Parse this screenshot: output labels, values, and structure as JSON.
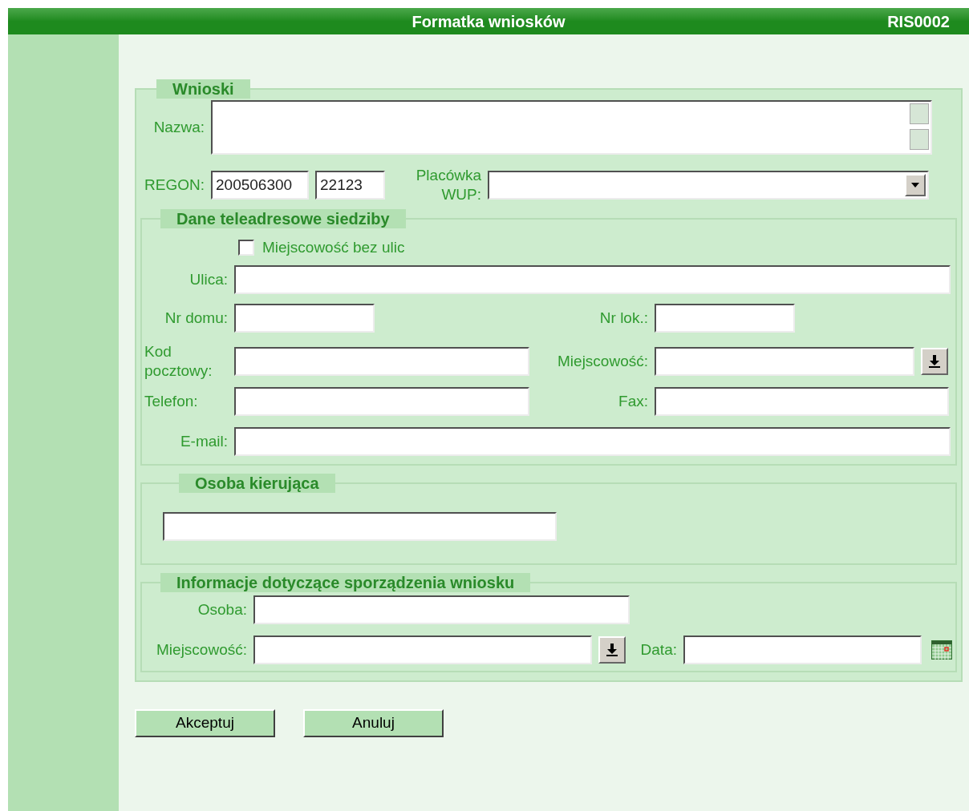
{
  "header": {
    "title": "Formatka wniosków",
    "code": "RIS0002"
  },
  "wnioski": {
    "legend": "Wnioski",
    "nazwa": {
      "label": "Nazwa:"
    },
    "regon": {
      "label": "REGON:",
      "value": "200506300",
      "suffix": "22123"
    },
    "placowka": {
      "label": "Placówka WUP:"
    }
  },
  "siedziba": {
    "legend": "Dane teleadresowe siedziby",
    "bez_ulic": {
      "label": "Miejscowość bez ulic",
      "checked": false
    },
    "ulica": {
      "label": "Ulica:"
    },
    "nr_domu": {
      "label": "Nr domu:"
    },
    "nr_lok": {
      "label": "Nr lok.:"
    },
    "kod": {
      "label": "Kod pocztowy:"
    },
    "miejscowosc": {
      "label": "Miejscowość:"
    },
    "telefon": {
      "label": "Telefon:"
    },
    "fax": {
      "label": "Fax:"
    },
    "email": {
      "label": "E-mail:"
    }
  },
  "kierujaca": {
    "legend": "Osoba kierująca"
  },
  "informacje": {
    "legend": "Informacje dotyczące sporządzenia wniosku",
    "osoba": {
      "label": "Osoba:"
    },
    "miejscowosc": {
      "label": "Miejscowość:"
    },
    "data": {
      "label": "Data:"
    }
  },
  "buttons": [
    "Akceptuj",
    "Anuluj"
  ]
}
